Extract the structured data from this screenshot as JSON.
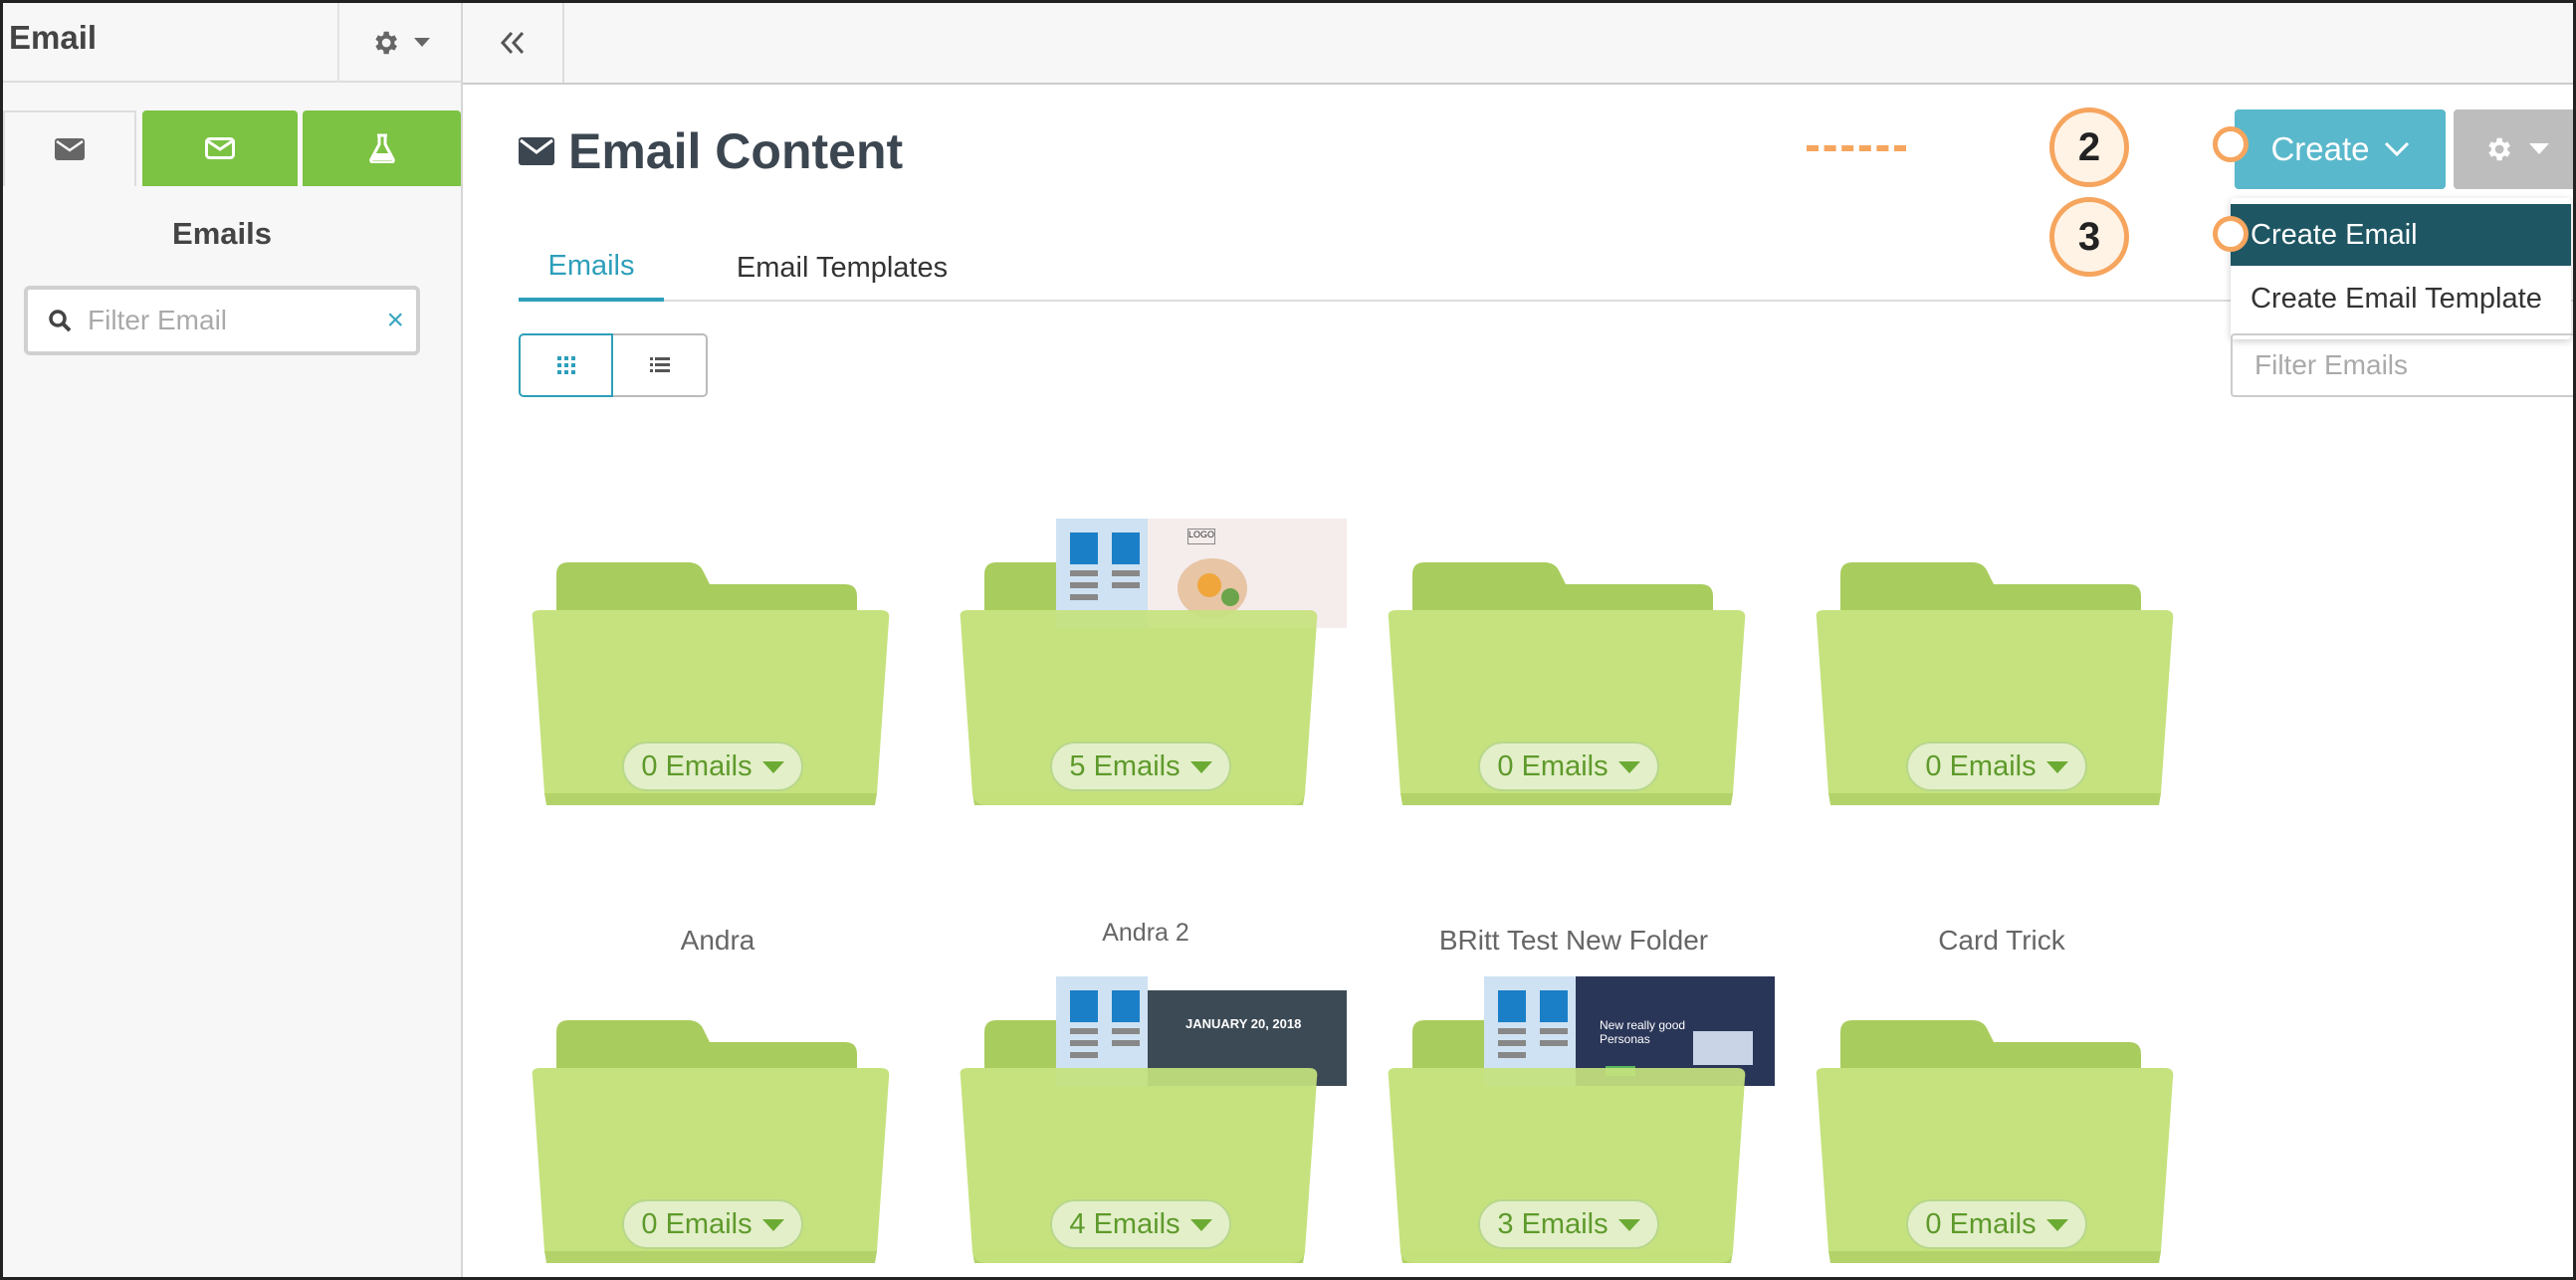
{
  "sidebar": {
    "title": "Email",
    "heading": "Emails",
    "filter_placeholder": "Filter Email",
    "clear_label": "×"
  },
  "main": {
    "page_title": "Email Content",
    "tabs": [
      {
        "label": "Emails",
        "active": true
      },
      {
        "label": "Email Templates",
        "active": false
      }
    ],
    "create_label": "Create",
    "create_menu": [
      {
        "label": "Create Email",
        "selected": true
      },
      {
        "label": "Create Email Template",
        "selected": false
      }
    ],
    "filter_emails_placeholder": "Filter Emails",
    "folders": [
      {
        "name": "Andra",
        "count": "0 Emails"
      },
      {
        "name": "Andra 2",
        "count": "5 Emails"
      },
      {
        "name": "BRitt Test New Folder",
        "count": "0 Emails"
      },
      {
        "name": "Card Trick",
        "count": "0 Emails"
      },
      {
        "name": "",
        "count": "0 Emails"
      },
      {
        "name": "",
        "count": "4 Emails"
      },
      {
        "name": "",
        "count": "3 Emails"
      },
      {
        "name": "",
        "count": "0 Emails"
      }
    ],
    "thumbnails": {
      "logo_text": "LOGO",
      "event_date": "JANUARY 20, 2018",
      "personas_text": "New really good Personas"
    }
  },
  "annotations": [
    {
      "number": "2"
    },
    {
      "number": "3"
    }
  ],
  "colors": {
    "accent": "#2e9fba",
    "create_button": "#5ab8cc",
    "selected_menu": "#1f5663",
    "sidebar_tab_green": "#7cc243",
    "folder_green": "#c5e27e",
    "annotation_orange": "#f6a55e"
  }
}
